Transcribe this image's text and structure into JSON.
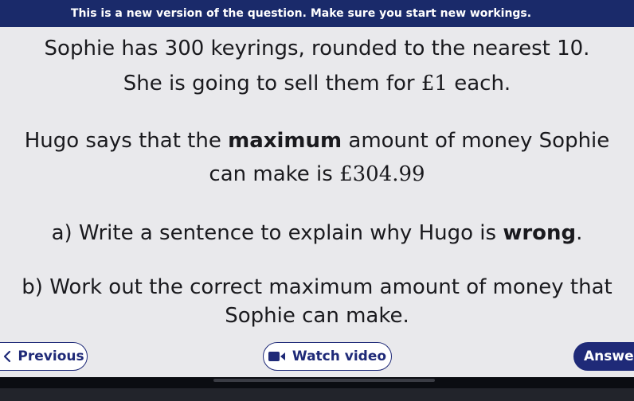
{
  "banner": {
    "text": "This is a new version of the question. Make sure you start new workings."
  },
  "question": {
    "line1": "Sophie has 300 keyrings, rounded to the nearest 10.",
    "line2_pre": "She is going to sell them for ",
    "line2_price": "£1",
    "line2_post": " each.",
    "line3_pre": "Hugo says that the ",
    "line3_bold": "maximum",
    "line3_post": " amount of money Sophie",
    "line4_pre": "can make is ",
    "line4_amount": "£304.99",
    "part_a_pre": "a) Write a sentence to explain why Hugo is ",
    "part_a_bold": "wrong",
    "part_a_post": ".",
    "part_b_line1": "b) Work out the correct maximum amount of money that",
    "part_b_line2": "Sophie can make."
  },
  "nav": {
    "previous_label": "Previous",
    "watch_video_label": "Watch video",
    "answer_label": "Answer"
  },
  "icons": {
    "previous": "chevron-left-icon",
    "video": "video-camera-icon"
  },
  "colors": {
    "banner_bg": "#1a2a6a",
    "accent": "#1f2a78",
    "panel_bg": "#e9e9ec"
  }
}
